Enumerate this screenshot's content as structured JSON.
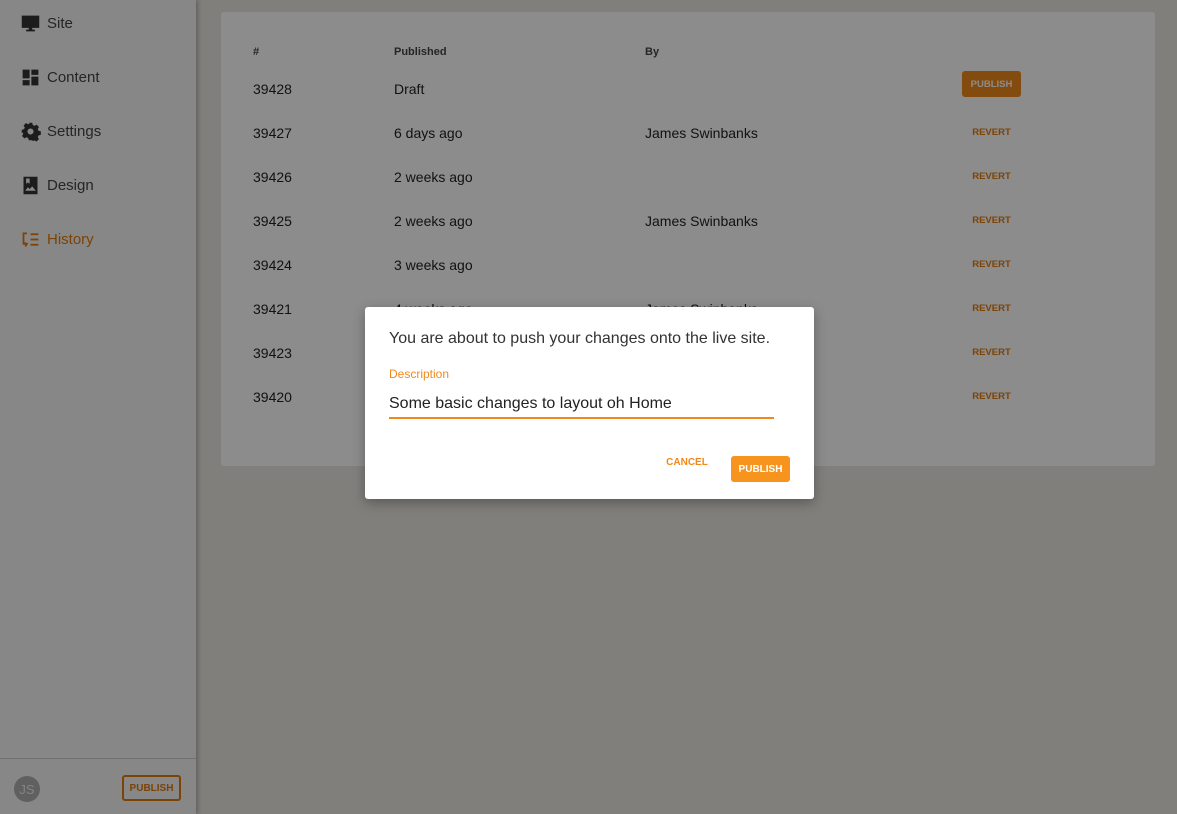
{
  "sidebar": {
    "items": [
      {
        "label": "Site",
        "icon": "monitor-icon"
      },
      {
        "label": "Content",
        "icon": "dashboard-icon"
      },
      {
        "label": "Settings",
        "icon": "gear-icon"
      },
      {
        "label": "Design",
        "icon": "image-icon"
      },
      {
        "label": "History",
        "icon": "history-icon",
        "active": true
      }
    ],
    "user_initials": "JS",
    "publish_label": "PUBLISH"
  },
  "table": {
    "headers": [
      "#",
      "Published",
      "By"
    ],
    "rows": [
      {
        "id": "39428",
        "published": "Draft",
        "by": "",
        "action": "PUBLISH"
      },
      {
        "id": "39427",
        "published": "6 days ago",
        "by": "James Swinbanks",
        "action": "REVERT"
      },
      {
        "id": "39426",
        "published": "2 weeks ago",
        "by": "",
        "action": "REVERT"
      },
      {
        "id": "39425",
        "published": "2 weeks ago",
        "by": "James Swinbanks",
        "action": "REVERT"
      },
      {
        "id": "39424",
        "published": "3 weeks ago",
        "by": "",
        "action": "REVERT"
      },
      {
        "id": "39421",
        "published": "4 weeks ago",
        "by": "James Swinbanks",
        "action": "REVERT"
      },
      {
        "id": "39423",
        "published": "",
        "by": "",
        "action": "REVERT"
      },
      {
        "id": "39420",
        "published": "",
        "by": "",
        "action": "REVERT"
      }
    ]
  },
  "modal": {
    "message": "You are about to push your changes onto the live site.",
    "field_label": "Description",
    "field_value": "Some basic changes to layout oh Home",
    "cancel_label": "CANCEL",
    "publish_label": "PUBLISH"
  },
  "colors": {
    "accent": "#f7941d"
  }
}
